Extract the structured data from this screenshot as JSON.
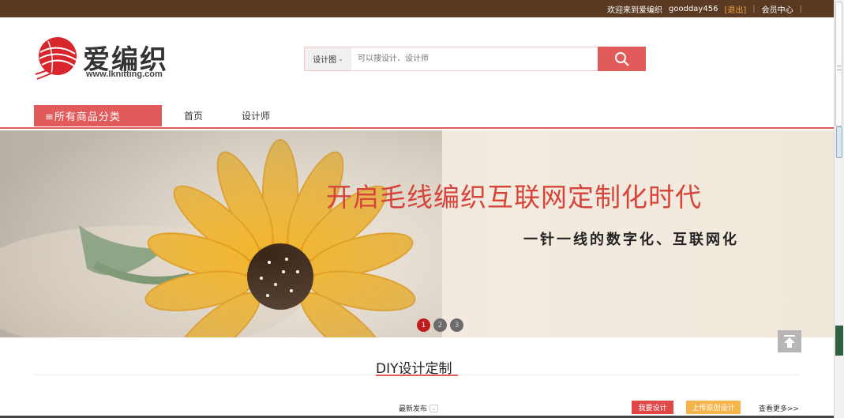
{
  "topbar": {
    "welcome": "欢迎来到爱编织",
    "username": "goodday456",
    "logout": "[退出]",
    "member_center": "会员中心",
    "separator": "|"
  },
  "logo": {
    "name": "爱编织",
    "url_text": "www.lknitting.com"
  },
  "search": {
    "category": "设计图",
    "placeholder": "可以搜设计、设计师"
  },
  "nav": {
    "all_categories": "≡所有商品分类",
    "home": "首页",
    "designers": "设计师"
  },
  "banner": {
    "headline": "开启毛线编织互联网定制化时代",
    "subline": "一针一线的数字化、互联网化",
    "dots": [
      "1",
      "2",
      "3"
    ],
    "active_dot": 1
  },
  "section": {
    "title": "DIY设计定制",
    "latest_label": "最新发布",
    "want_design": "我要设计",
    "upload_design": "上传原创设计",
    "more": "查看更多>>"
  },
  "colors": {
    "topbar": "#5a3a22",
    "accent": "#e25b5b",
    "orange": "#f5b54a"
  }
}
